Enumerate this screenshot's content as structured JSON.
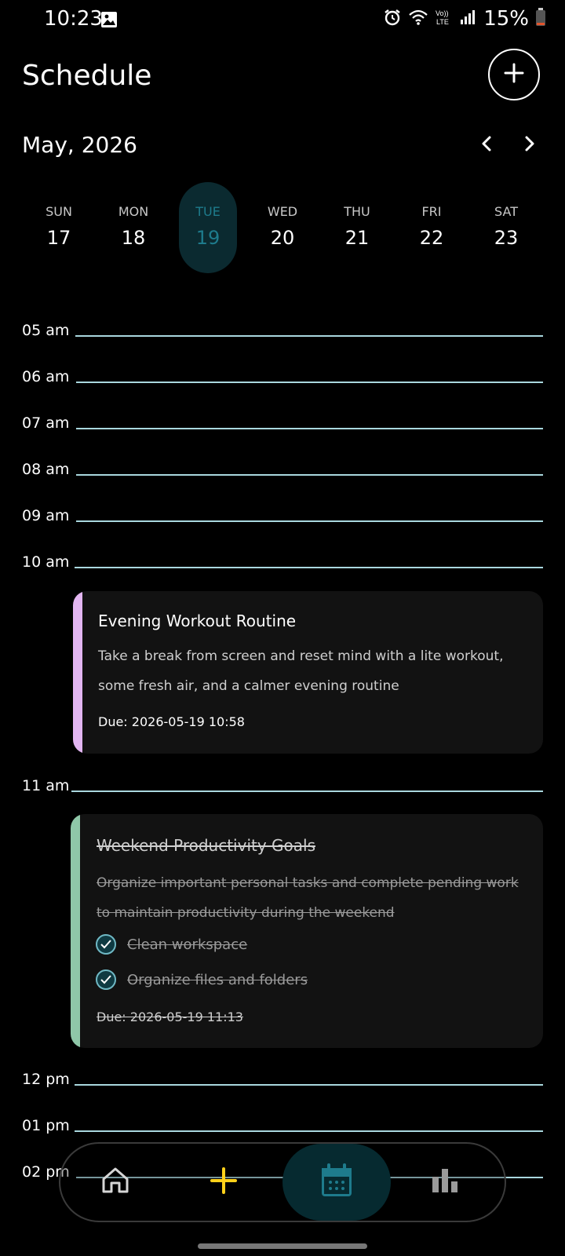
{
  "status": {
    "time": "10:23",
    "battery": "15%"
  },
  "header": {
    "title": "Schedule"
  },
  "calendar": {
    "month": "May, 2026",
    "days": [
      {
        "name": "SUN",
        "num": "17"
      },
      {
        "name": "MON",
        "num": "18"
      },
      {
        "name": "TUE",
        "num": "19"
      },
      {
        "name": "WED",
        "num": "20"
      },
      {
        "name": "THU",
        "num": "21"
      },
      {
        "name": "FRI",
        "num": "22"
      },
      {
        "name": "SAT",
        "num": "23"
      }
    ],
    "selected_day": "19"
  },
  "hours": [
    "05 am",
    "06 am",
    "07 am",
    "08 am",
    "09 am",
    "10 am",
    "11 am",
    "12 pm",
    "01 pm",
    "02 pm"
  ],
  "tasks": [
    {
      "title": "Evening Workout Routine",
      "description": "Take a break from screen and reset mind with a lite workout, some fresh air, and a calmer evening routine",
      "due": "Due: 2026-05-19 10:58",
      "accent": "#e3b6f2",
      "completed": false
    },
    {
      "title": "Weekend Productivity Goals",
      "description": "Organize important personal tasks and complete pending work to maintain productivity during the weekend",
      "subtasks": [
        "Clean workspace",
        "Organize files and folders"
      ],
      "due": "Due: 2026-05-19 11:13",
      "accent": "#8fc7a8",
      "completed": true
    }
  ],
  "nav": {
    "items": [
      "home-icon",
      "add-icon",
      "calendar-icon",
      "stats-icon"
    ],
    "active": "calendar-icon",
    "accent": "#ffd11a",
    "active_color": "#1e7b8c"
  }
}
